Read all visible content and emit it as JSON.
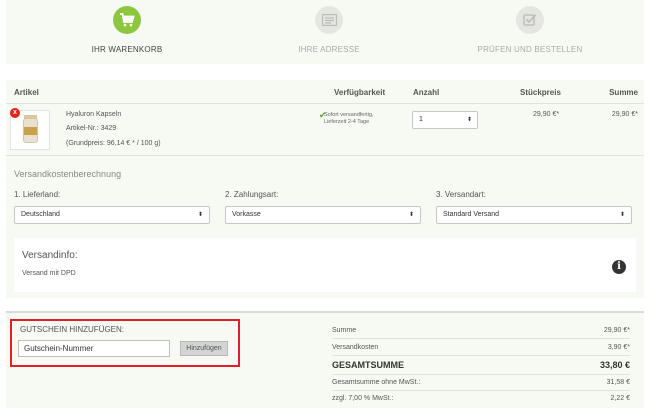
{
  "steps": [
    {
      "label": "IHR WARENKORB",
      "icon": "cart-icon"
    },
    {
      "label": "IHRE ADRESSE",
      "icon": "address-card-icon"
    },
    {
      "label": "PRÜFEN UND BESTELLEN",
      "icon": "checkmark-icon"
    }
  ],
  "table": {
    "headers": {
      "article": "Artikel",
      "availability": "Verfügbarkeit",
      "quantity": "Anzahl",
      "unit_price": "Stückpreis",
      "total": "Summe"
    }
  },
  "item": {
    "remove": "x",
    "name": "Hyaluron Kapseln",
    "article_no": "Artikel-Nr.: 3429",
    "base_price": "(Grundpreis: 96,14 € * / 100 g)",
    "availability_line1": "Sofort versandfertig,",
    "availability_line2": "Lieferzeit 2-4 Tage",
    "quantity": "1",
    "unit_price": "29,90 €*",
    "total": "29,90 €*"
  },
  "shipping_calc": {
    "title": "Versandkostenberechnung",
    "country_label": "1. Lieferland:",
    "country_value": "Deutschland",
    "payment_label": "2. Zahlungsart:",
    "payment_value": "Vorkasse",
    "shipping_label": "3. Versandart:",
    "shipping_value": "Standard Versand",
    "info_title": "Versandinfo:",
    "info_text": "Versand mit DPD",
    "info_icon": "i"
  },
  "coupon": {
    "title": "GUTSCHEIN HINZUFÜGEN:",
    "placeholder": "Gutschein-Nummer",
    "button": "Hinzufügen"
  },
  "summary": {
    "subtotal_label": "Summe",
    "subtotal_value": "29,90 €*",
    "shipping_label": "Versandkosten",
    "shipping_value": "3,90 €*",
    "grand_total_label": "GESAMTSUMME",
    "grand_total_value": "33,80 €",
    "net_label": "Gesamtsumme ohne MwSt.:",
    "net_value": "31,58 €",
    "vat_label": "zzgl. 7,00 % MwSt.:",
    "vat_value": "2,22 €"
  },
  "colors": {
    "accent": "#8dc63f",
    "highlight": "#e01f26",
    "panel": "#f7faf3"
  }
}
